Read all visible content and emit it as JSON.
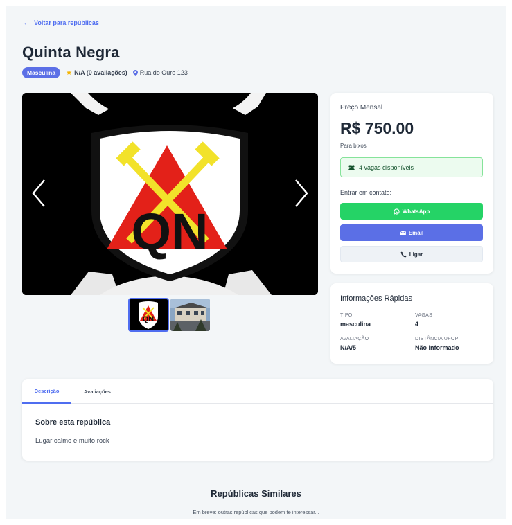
{
  "nav": {
    "back_label": "Voltar para repúblicas"
  },
  "republic": {
    "name": "Quinta Negra",
    "type_badge": "Masculina",
    "rating_text": "N/A (0 avaliações)",
    "address": "Rua do Ouro 123"
  },
  "gallery": {
    "thumbnails": [
      "thumbnail-logo",
      "thumbnail-house-photo"
    ],
    "logo_letters": "QN",
    "active_index": 0
  },
  "pricing": {
    "label": "Preço Mensal",
    "price": "R$ 750.00",
    "target": "Para bixos",
    "vacancies": "4 vagas disponíveis",
    "contact_label": "Entrar em contato:",
    "whatsapp_label": "WhatsApp",
    "email_label": "Email",
    "call_label": "Ligar"
  },
  "quick_info": {
    "title": "Informações Rápidas",
    "type_key": "TIPO",
    "type_val": "masculina",
    "vacancies_key": "VAGAS",
    "vacancies_val": "4",
    "rating_key": "AVALIAÇÃO",
    "rating_val": "N/A/5",
    "distance_key": "DISTÂNCIA UFOP",
    "distance_val": "Não informado"
  },
  "tabs": {
    "items": [
      "Descrição",
      "Avaliações"
    ],
    "active": "Descrição",
    "section_title": "Sobre esta república",
    "section_text": "Lugar calmo e muito rock"
  },
  "similar": {
    "title": "Repúblicas Similares",
    "subtitle": "Em breve: outras repúblicas que podem te interessar..."
  },
  "colors": {
    "accent": "#4f6df0",
    "badge": "#5b6fe6",
    "whatsapp": "#25d366",
    "vacancy_bg": "#ecfbef",
    "vacancy_border": "#86e39a",
    "page_bg": "#f3f6f8"
  }
}
